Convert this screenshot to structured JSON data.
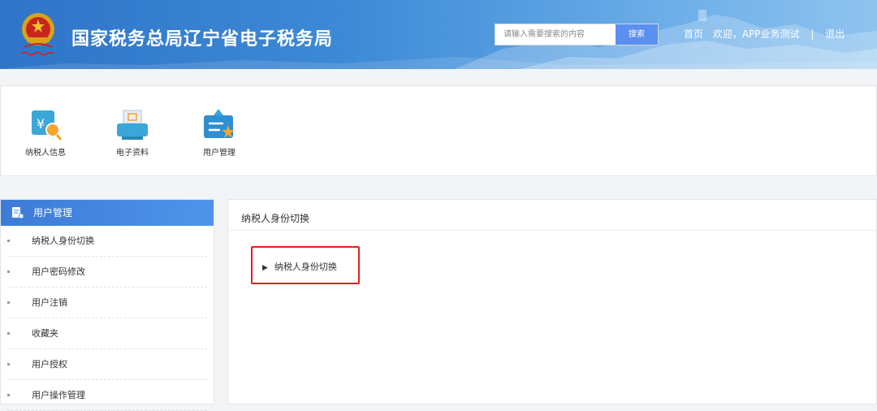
{
  "header": {
    "site_title": "国家税务总局辽宁省电子税务局",
    "search_placeholder": "请输入需要搜索的内容",
    "search_button": "搜索",
    "nav_home": "首页",
    "nav_welcome": "欢迎，APP业务测试",
    "nav_separator": "|",
    "nav_logout": "退出"
  },
  "quick_links": [
    {
      "label": "纳税人信息",
      "icon": "taxpayer-info-icon"
    },
    {
      "label": "电子资料",
      "icon": "electronic-docs-icon"
    },
    {
      "label": "用户管理",
      "icon": "user-management-icon"
    }
  ],
  "sidebar": {
    "title": "用户管理",
    "items": [
      {
        "label": "纳税人身份切换"
      },
      {
        "label": "用户密码修改"
      },
      {
        "label": "用户注销"
      },
      {
        "label": "收藏夹"
      },
      {
        "label": "用户授权"
      },
      {
        "label": "用户操作管理"
      }
    ]
  },
  "content": {
    "title": "纳税人身份切换",
    "link_arrow": "▶",
    "link_label": "纳税人身份切换"
  },
  "colors": {
    "header_blue": "#3d8ad6",
    "sidebar_header": "#4f94ea",
    "search_button": "#5b8ff0",
    "highlight_border": "#e32020"
  }
}
